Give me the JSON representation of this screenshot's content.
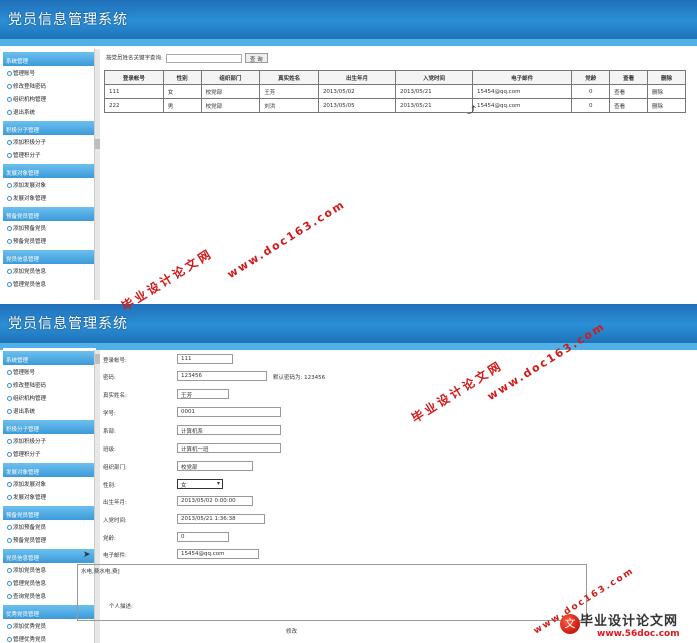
{
  "app_title": "党员信息管理系统",
  "sidebar": {
    "groups": [
      {
        "title": "系统管理",
        "items": [
          "管理账号",
          "修改登陆密码",
          "组织机构管理",
          "退出系统"
        ]
      },
      {
        "title": "积极分子管理",
        "items": [
          "添加积极分子",
          "管理积分子"
        ]
      },
      {
        "title": "发展对象管理",
        "items": [
          "添加发展对象",
          "发展对象管理"
        ]
      },
      {
        "title": "预备党员管理",
        "items": [
          "添加预备党员",
          "预备党员管理"
        ]
      },
      {
        "title": "党员信息管理",
        "items": [
          "添加党员信息",
          "管理党员信息"
        ]
      }
    ],
    "groups2": [
      {
        "title": "系统管理",
        "items": [
          "管理账号",
          "修改登陆密码",
          "组织机构管理",
          "退出系统"
        ]
      },
      {
        "title": "积极分子管理",
        "items": [
          "添加积极分子",
          "管理积分子"
        ]
      },
      {
        "title": "发展对象管理",
        "items": [
          "添加发展对象",
          "发展对象管理"
        ]
      },
      {
        "title": "预备党员管理",
        "items": [
          "添加预备党员",
          "预备党员管理"
        ]
      },
      {
        "title": "党员信息管理",
        "items": [
          "添加党员信息",
          "管理党员信息",
          "查询党员信息"
        ]
      },
      {
        "title": "优秀党员管理",
        "items": [
          "添加优秀党员",
          "管理优秀党员"
        ]
      }
    ]
  },
  "search": {
    "label": "按党员姓名关键字查询:",
    "button": "查 询"
  },
  "table": {
    "headers": [
      "登录帐号",
      "性别",
      "组织部门",
      "真实姓名",
      "出生年月",
      "入党时间",
      "电子邮件",
      "党龄",
      "查看",
      "删除"
    ],
    "rows": [
      [
        "111",
        "女",
        "校党部",
        "王芳",
        "2013/05/02",
        "2013/05/21",
        "15454@qq.com",
        "0",
        "查看",
        "删除"
      ],
      [
        "222",
        "男",
        "校党部",
        "刘洪",
        "2013/05/05",
        "2013/05/21",
        "15454@qq.com",
        "0",
        "查看",
        "删除"
      ]
    ]
  },
  "form": {
    "fields": [
      {
        "label": "登录帐号:",
        "value": "111"
      },
      {
        "label": "密码:",
        "value": "123456",
        "extra": "默认密码为: 123456"
      },
      {
        "label": "真实姓名:",
        "value": "王芳"
      },
      {
        "label": "学号:",
        "value": "0001"
      },
      {
        "label": "系部:",
        "value": "计算机系"
      },
      {
        "label": "班级:",
        "value": "计算机一班"
      },
      {
        "label": "组织部门:",
        "value": "校党部"
      },
      {
        "label": "性别:",
        "value": "女"
      },
      {
        "label": "出生年月:",
        "value": "2013/05/02 0:00:00"
      },
      {
        "label": "入党时间:",
        "value": "2013/05/21 1:36:38"
      },
      {
        "label": "党龄:",
        "value": "0"
      },
      {
        "label": "电子邮件:",
        "value": "15454@qq.com"
      }
    ],
    "desc_label": "个人描述:",
    "desc_value": "水电,费水电,费]",
    "submit": "修改"
  },
  "watermarks": {
    "url": "www.doc163.com",
    "cn": "毕业设计论文网"
  },
  "logo": {
    "cn": "毕业设计论文网",
    "url": "www.56doc.com"
  },
  "colors": {
    "header": "#2b8fd6",
    "sidebar_group": "#4aa8e0",
    "watermark": "#d21a1a"
  }
}
